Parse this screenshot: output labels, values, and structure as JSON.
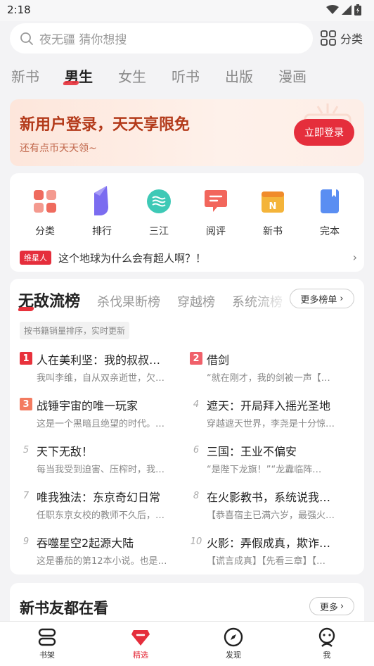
{
  "status_bar": {
    "time": "2:18"
  },
  "search": {
    "placeholder": "夜无疆 猜你想搜",
    "category_label": "分类"
  },
  "tabs": [
    {
      "label": "新书",
      "active": false
    },
    {
      "label": "男生",
      "active": true
    },
    {
      "label": "女生",
      "active": false
    },
    {
      "label": "听书",
      "active": false
    },
    {
      "label": "出版",
      "active": false
    },
    {
      "label": "漫画",
      "active": false
    }
  ],
  "promo": {
    "title": "新用户登录，天天享限免",
    "subtitle": "还有点币天天领~",
    "button": "立即登录"
  },
  "shortcuts": [
    {
      "label": "分类",
      "icon": "grid-icon",
      "color": "#ef6b5e"
    },
    {
      "label": "排行",
      "icon": "leaderboard-icon",
      "color": "#7b6cf0"
    },
    {
      "label": "三江",
      "icon": "river-icon",
      "color": "#3ec9b6"
    },
    {
      "label": "阅评",
      "icon": "comment-icon",
      "color": "#f2665c"
    },
    {
      "label": "新书",
      "icon": "new-book-icon",
      "color": "#f4b43a"
    },
    {
      "label": "完本",
      "icon": "finished-book-icon",
      "color": "#5a8ef2"
    }
  ],
  "notice": {
    "badge": "维星人",
    "text": "这个地球为什么会有超人啊？！"
  },
  "ranking": {
    "tabs": [
      "无敌流榜",
      "杀伐果断榜",
      "穿越榜",
      "系统流榜"
    ],
    "more_label": "更多榜单",
    "hint": "按书籍销量排序，实时更新",
    "items": [
      {
        "rank": "1",
        "title": "人在美利坚：我的叔叔…",
        "desc": "我叫李维，自从双亲逝世，欠…"
      },
      {
        "rank": "2",
        "title": "借剑",
        "desc": "“就在刚才，我的剑被一声【…"
      },
      {
        "rank": "3",
        "title": "战锤宇宙的唯一玩家",
        "desc": "这是一个黑暗且绝望的时代。…"
      },
      {
        "rank": "4",
        "title": "遮天：开局拜入摇光圣地",
        "desc": "穿越遮天世界，李尧是十分惊…"
      },
      {
        "rank": "5",
        "title": "天下无敌！",
        "desc": "每当我受到迫害、压榨时，我…"
      },
      {
        "rank": "6",
        "title": "三国：王业不偏安",
        "desc": "“是陛下龙旗！”“龙纛临阵…"
      },
      {
        "rank": "7",
        "title": "唯我独法：东京奇幻日常",
        "desc": "任职东京女校的教师不久后，…"
      },
      {
        "rank": "8",
        "title": "在火影教书，系统说我…",
        "desc": "【恭喜宿主已满六岁，最强火…"
      },
      {
        "rank": "9",
        "title": "吞噬星空2起源大陆",
        "desc": "这是番茄的第12本小说。也是…"
      },
      {
        "rank": "10",
        "title": "火影：弄假成真，欺诈…",
        "desc": "【谎言成真】【先看三章】【…"
      }
    ]
  },
  "new_section": {
    "title": "新书友都在看",
    "more_label": "更多"
  },
  "bottom_nav": [
    {
      "label": "书架",
      "icon": "bookshelf-icon",
      "active": false
    },
    {
      "label": "精选",
      "icon": "featured-icon",
      "active": true
    },
    {
      "label": "发现",
      "icon": "compass-icon",
      "active": false
    },
    {
      "label": "我",
      "icon": "profile-icon",
      "active": false
    }
  ]
}
